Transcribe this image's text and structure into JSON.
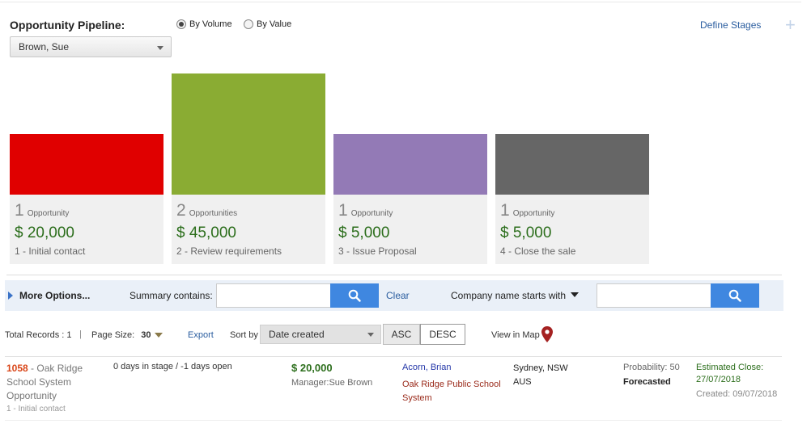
{
  "header": {
    "title": "Opportunity Pipeline:",
    "user_select": "Brown, Sue",
    "by_volume_label": "By Volume",
    "by_value_label": "By Value",
    "mode_selected": "By Volume",
    "define_stages": "Define Stages",
    "add_icon": "+"
  },
  "stages": [
    {
      "count": "1",
      "count_label": "Opportunity",
      "amount": "$ 20,000",
      "name": "1 - Initial contact",
      "color": "#e00000"
    },
    {
      "count": "2",
      "count_label": "Opportunities",
      "amount": "$ 45,000",
      "name": "2 - Review requirements",
      "color": "#8aac33"
    },
    {
      "count": "1",
      "count_label": "Opportunity",
      "amount": "$ 5,000",
      "name": "3 - Issue Proposal",
      "color": "#937ab6"
    },
    {
      "count": "1",
      "count_label": "Opportunity",
      "amount": "$ 5,000",
      "name": "4 - Close the sale",
      "color": "#666666"
    }
  ],
  "filters": {
    "more_options": "More Options...",
    "summary_label": "Summary contains:",
    "summary_value": "",
    "clear": "Clear",
    "company_filter": "Company name  starts with",
    "company_value": ""
  },
  "toolbar": {
    "total_records": "Total Records : 1",
    "separator": "|",
    "page_size_label": "Page Size:",
    "page_size_value": "30",
    "export": "Export",
    "sort_by": "Sort by",
    "sort_value": "Date created",
    "asc": "ASC",
    "desc": "DESC",
    "view_in_map": "View in Map"
  },
  "records": [
    {
      "number": "1058",
      "title": " - Oak Ridge School System Opportunity",
      "stage": "1 - Initial contact",
      "days": "0 days in stage / -1 days open",
      "amount": "$ 20,000",
      "manager": "Manager:Sue Brown",
      "contact": "Acorn, Brian",
      "company": "Oak Ridge Public School System",
      "city": "Sydney, NSW",
      "country": "AUS",
      "probability": "Probability: 50",
      "forecast": "Forecasted",
      "estimated_close": "Estimated Close: 27/07/2018",
      "created": "Created: 09/07/2018"
    }
  ],
  "colors": {
    "accent": "#3f87e0",
    "link": "#2a5d9f",
    "money": "#2c6e1c",
    "record_number": "#d9471a",
    "map_pin": "#a52222"
  }
}
